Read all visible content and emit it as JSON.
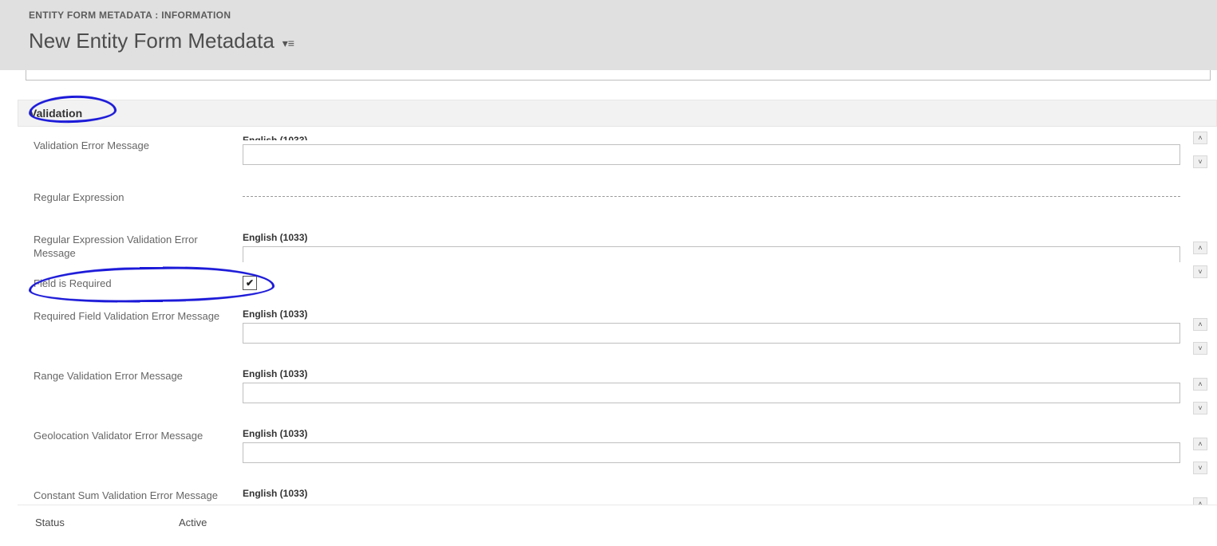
{
  "header": {
    "breadcrumb": "ENTITY FORM METADATA : INFORMATION",
    "title": "New Entity Form Metadata"
  },
  "section": {
    "title": "Validation"
  },
  "langLabelCut": "English (1033)",
  "langLabel": "English (1033)",
  "fields": {
    "validationErrorMessage": {
      "label": "Validation Error Message",
      "value": ""
    },
    "regularExpression": {
      "label": "Regular Expression",
      "value": ""
    },
    "regexValidationErrorMessage": {
      "label": "Regular Expression Validation Error Message",
      "value": ""
    },
    "fieldIsRequired": {
      "label": "Field is Required",
      "checked": "✔"
    },
    "requiredFieldValidationErrorMessage": {
      "label": "Required Field Validation Error Message",
      "value": ""
    },
    "rangeValidationErrorMessage": {
      "label": "Range Validation Error Message",
      "value": ""
    },
    "geolocationValidatorErrorMessage": {
      "label": "Geolocation Validator Error Message",
      "value": ""
    },
    "constantSumValidationErrorMessage": {
      "label": "Constant Sum Validation Error Message",
      "value": ""
    }
  },
  "status": {
    "label": "Status",
    "value": "Active"
  }
}
